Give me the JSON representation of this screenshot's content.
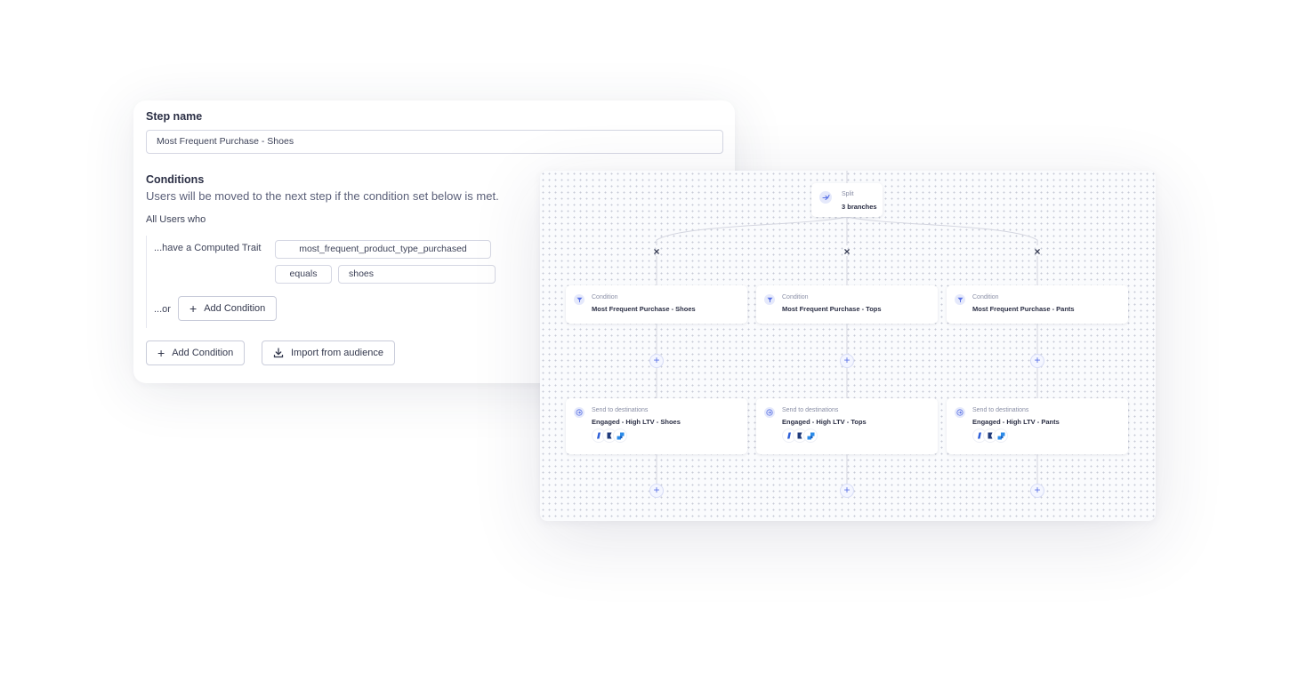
{
  "form": {
    "step_name_label": "Step name",
    "step_name_value": "Most Frequent Purchase - Shoes",
    "conditions_heading": "Conditions",
    "conditions_description": "Users will be moved to the next step if the condition set below is met.",
    "all_users_label": "All Users who",
    "condition": {
      "prefix": "...have a Computed Trait",
      "trait": "most_frequent_product_type_purchased",
      "operator": "equals",
      "value": "shoes"
    },
    "or_prefix": "...or",
    "inner_add_condition_label": "Add Condition",
    "add_condition_label": "Add Condition",
    "import_label": "Import from audience",
    "icons": {
      "add": "plus-icon",
      "import": "download-icon"
    }
  },
  "canvas": {
    "split": {
      "type": "Split",
      "title": "3 branches",
      "icon": "split-arrow-icon"
    },
    "branches": [
      {
        "condition": {
          "type": "Condition",
          "title": "Most Frequent Purchase - Shoes",
          "icon": "filter-icon"
        },
        "destination": {
          "type": "Send to destinations",
          "title": "Engaged - High LTV - Shoes",
          "icon": "send-arrow-icon"
        }
      },
      {
        "condition": {
          "type": "Condition",
          "title": "Most Frequent Purchase - Tops",
          "icon": "filter-icon"
        },
        "destination": {
          "type": "Send to destinations",
          "title": "Engaged - High LTV - Tops",
          "icon": "send-arrow-icon"
        }
      },
      {
        "condition": {
          "type": "Condition",
          "title": "Most Frequent Purchase - Pants",
          "icon": "filter-icon"
        },
        "destination": {
          "type": "Send to destinations",
          "title": "Engaged - High LTV - Pants",
          "icon": "send-arrow-icon"
        }
      }
    ],
    "remove_glyph": "×",
    "add_glyph": "+",
    "colors": {
      "accent": "#5a72e6",
      "icon_bg": "#e5e9fb",
      "line": "#d4d6e0"
    }
  }
}
